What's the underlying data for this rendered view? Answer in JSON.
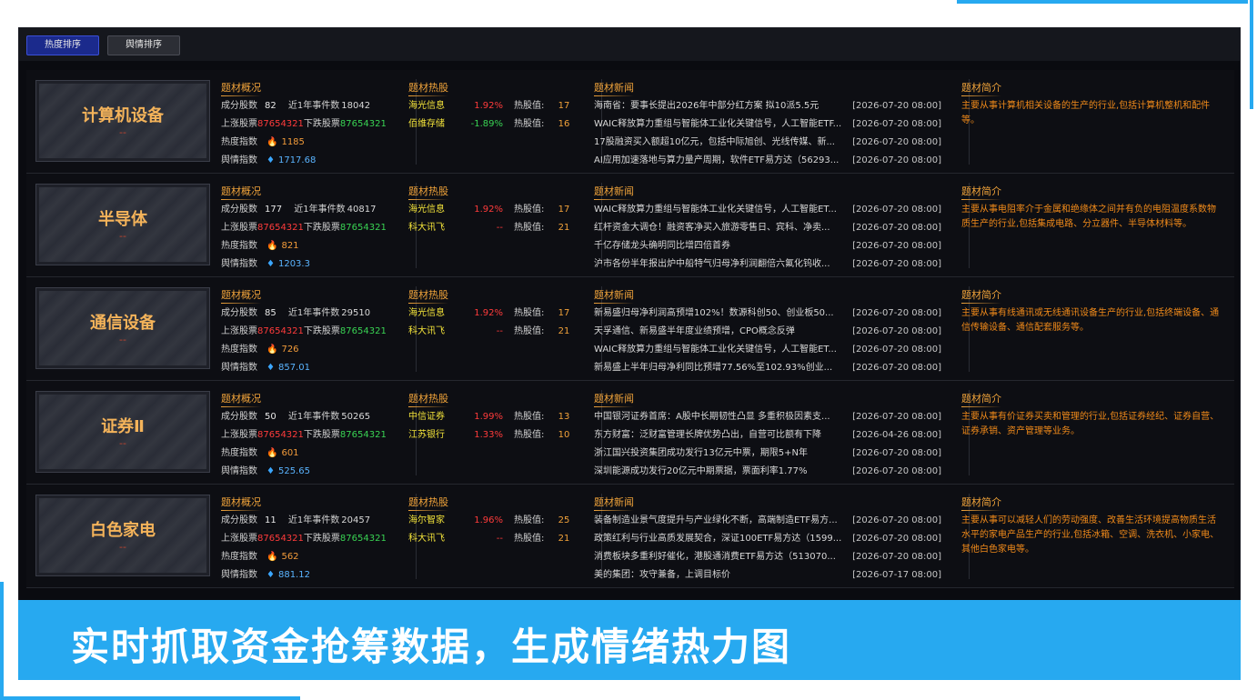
{
  "tabs": [
    "热度排序",
    "舆情排序"
  ],
  "headings": {
    "overview": "题材概况",
    "hot_stocks": "题材热股",
    "news": "题材新闻",
    "intro": "题材简介"
  },
  "labels": {
    "constituents": "成分股数",
    "events": "近1年事件数",
    "up_stocks": "上涨股票",
    "down_stocks": "下跌股票",
    "heat_index": "热度指数",
    "sentiment_index": "舆情指数",
    "heat_value": "热股值:"
  },
  "rows": [
    {
      "name": "计算机设备",
      "dash": "--",
      "constituents": "82",
      "events": "18042",
      "up": "87654321",
      "down": "87654321",
      "heat": "1185",
      "sentiment": "1717.68",
      "stocks": [
        {
          "name": "海光信息",
          "pct": "1.92%",
          "heat": "17",
          "dir": "up"
        },
        {
          "name": "佰维存储",
          "pct": "-1.89%",
          "heat": "16",
          "dir": "down"
        }
      ],
      "news": [
        {
          "title": "海南省：要事长提出2026年中部分红方案 拟10派5.5元",
          "date": "[2026-07-20 08:00]"
        },
        {
          "title": "WAIC释放算力重组与智能体工业化关键信号，人工智能ETF...",
          "date": "[2026-07-20 08:00]"
        },
        {
          "title": "17股融资买入额超10亿元，包括中际旭创、光线传媒、新...",
          "date": "[2026-07-20 08:00]"
        },
        {
          "title": "AI应用加速落地与算力量产周期，软件ETF易方达（56293...",
          "date": "[2026-07-20 08:00]"
        }
      ],
      "intro": "主要从事计算机相关设备的生产的行业,包括计算机整机和配件等。"
    },
    {
      "name": "半导体",
      "dash": "--",
      "constituents": "177",
      "events": "40817",
      "up": "87654321",
      "down": "87654321",
      "heat": "821",
      "sentiment": "1203.3",
      "stocks": [
        {
          "name": "海光信息",
          "pct": "1.92%",
          "heat": "17",
          "dir": "up"
        },
        {
          "name": "科大讯飞",
          "pct": "--",
          "heat": "21",
          "dir": "flat"
        }
      ],
      "news": [
        {
          "title": "WAIC释放算力重组与智能体工业化关键信号，人工智能ET...",
          "date": "[2026-07-20 08:00]"
        },
        {
          "title": "红杆资金大调仓！融资客净买入旅游零售日、宾科、净卖...",
          "date": "[2026-07-20 08:00]"
        },
        {
          "title": "千亿存储龙头确明同比增四倍首券",
          "date": "[2026-07-20 08:00]"
        },
        {
          "title": "沪市各份半年报出炉中船特气归母净利润翻倍六氟化钨收...",
          "date": "[2026-07-20 08:00]"
        }
      ],
      "intro": "主要从事电阻率介于金属和绝缘体之间并有负的电阻温度系数物质生产的行业,包括集成电路、分立器件、半导体材料等。"
    },
    {
      "name": "通信设备",
      "dash": "--",
      "constituents": "85",
      "events": "29510",
      "up": "87654321",
      "down": "87654321",
      "heat": "726",
      "sentiment": "857.01",
      "stocks": [
        {
          "name": "海光信息",
          "pct": "1.92%",
          "heat": "17",
          "dir": "up"
        },
        {
          "name": "科大讯飞",
          "pct": "--",
          "heat": "21",
          "dir": "flat"
        }
      ],
      "news": [
        {
          "title": "新易盛归母净利润高预增102%！数源科创50、创业板50...",
          "date": "[2026-07-20 08:00]"
        },
        {
          "title": "天孚通信、新易盛半年度业绩预增，CPO概念反弹",
          "date": "[2026-07-20 08:00]"
        },
        {
          "title": "WAIC释放算力重组与智能体工业化关键信号，人工智能ET...",
          "date": "[2026-07-20 08:00]"
        },
        {
          "title": "新易盛上半年归母净利同比预增77.56%至102.93%创业...",
          "date": "[2026-07-20 08:00]"
        }
      ],
      "intro": "主要从事有线通讯或无线通讯设备生产的行业,包括终端设备、通信传输设备、通信配套服务等。"
    },
    {
      "name": "证券Ⅱ",
      "dash": "--",
      "constituents": "50",
      "events": "50265",
      "up": "87654321",
      "down": "87654321",
      "heat": "601",
      "sentiment": "525.65",
      "stocks": [
        {
          "name": "中信证券",
          "pct": "1.99%",
          "heat": "13",
          "dir": "up"
        },
        {
          "name": "江苏银行",
          "pct": "1.33%",
          "heat": "10",
          "dir": "up"
        }
      ],
      "news": [
        {
          "title": "中国银河证券首席：A股中长期韧性凸显 多重积极因素支...",
          "date": "[2026-07-20 08:00]"
        },
        {
          "title": "东方财富：泛财富管理长牌优势凸出，自营可比额有下降",
          "date": "[2026-04-26 08:00]"
        },
        {
          "title": "浙江国兴投资集团成功发行13亿元中票，期限5+N年",
          "date": "[2026-07-20 08:00]"
        },
        {
          "title": "深圳能源成功发行20亿元中期票据，票面利率1.77%",
          "date": "[2026-07-20 08:00]"
        }
      ],
      "intro": "主要从事有价证券买卖和管理的行业,包括证券经纪、证券自营、证券承销、资产管理等业务。"
    },
    {
      "name": "白色家电",
      "dash": "--",
      "constituents": "11",
      "events": "20457",
      "up": "87654321",
      "down": "87654321",
      "heat": "562",
      "sentiment": "881.12",
      "stocks": [
        {
          "name": "海尔智家",
          "pct": "1.96%",
          "heat": "25",
          "dir": "up"
        },
        {
          "name": "科大讯飞",
          "pct": "--",
          "heat": "21",
          "dir": "flat"
        }
      ],
      "news": [
        {
          "title": "装备制造业景气度提升与产业绿化不断，高端制造ETF易方...",
          "date": "[2026-07-20 08:00]"
        },
        {
          "title": "政策红利与行业高质发展契合，深证100ETF易方达（1599...",
          "date": "[2026-07-20 08:00]"
        },
        {
          "title": "消费板块多重利好催化，港股通消费ETF易方达（513070...",
          "date": "[2026-07-20 08:00]"
        },
        {
          "title": "美的集团：攻守兼备，上调目标价",
          "date": "[2026-07-17 08:00]"
        }
      ],
      "intro": "主要从事可以减轻人们的劳动强度、改善生活环境提高物质生活水平的家电产品生产的行业,包括冰箱、空调、洗衣机、小家电、其他白色家电等。"
    }
  ],
  "banner": "实时抓取资金抢筹数据，生成情绪热力图",
  "colors": {
    "accent_blue": "#27a9f0",
    "up_red": "#ff3b3b",
    "down_green": "#39d353",
    "title_orange": "#f0a33a",
    "stock_yellow": "#f2e23a"
  }
}
